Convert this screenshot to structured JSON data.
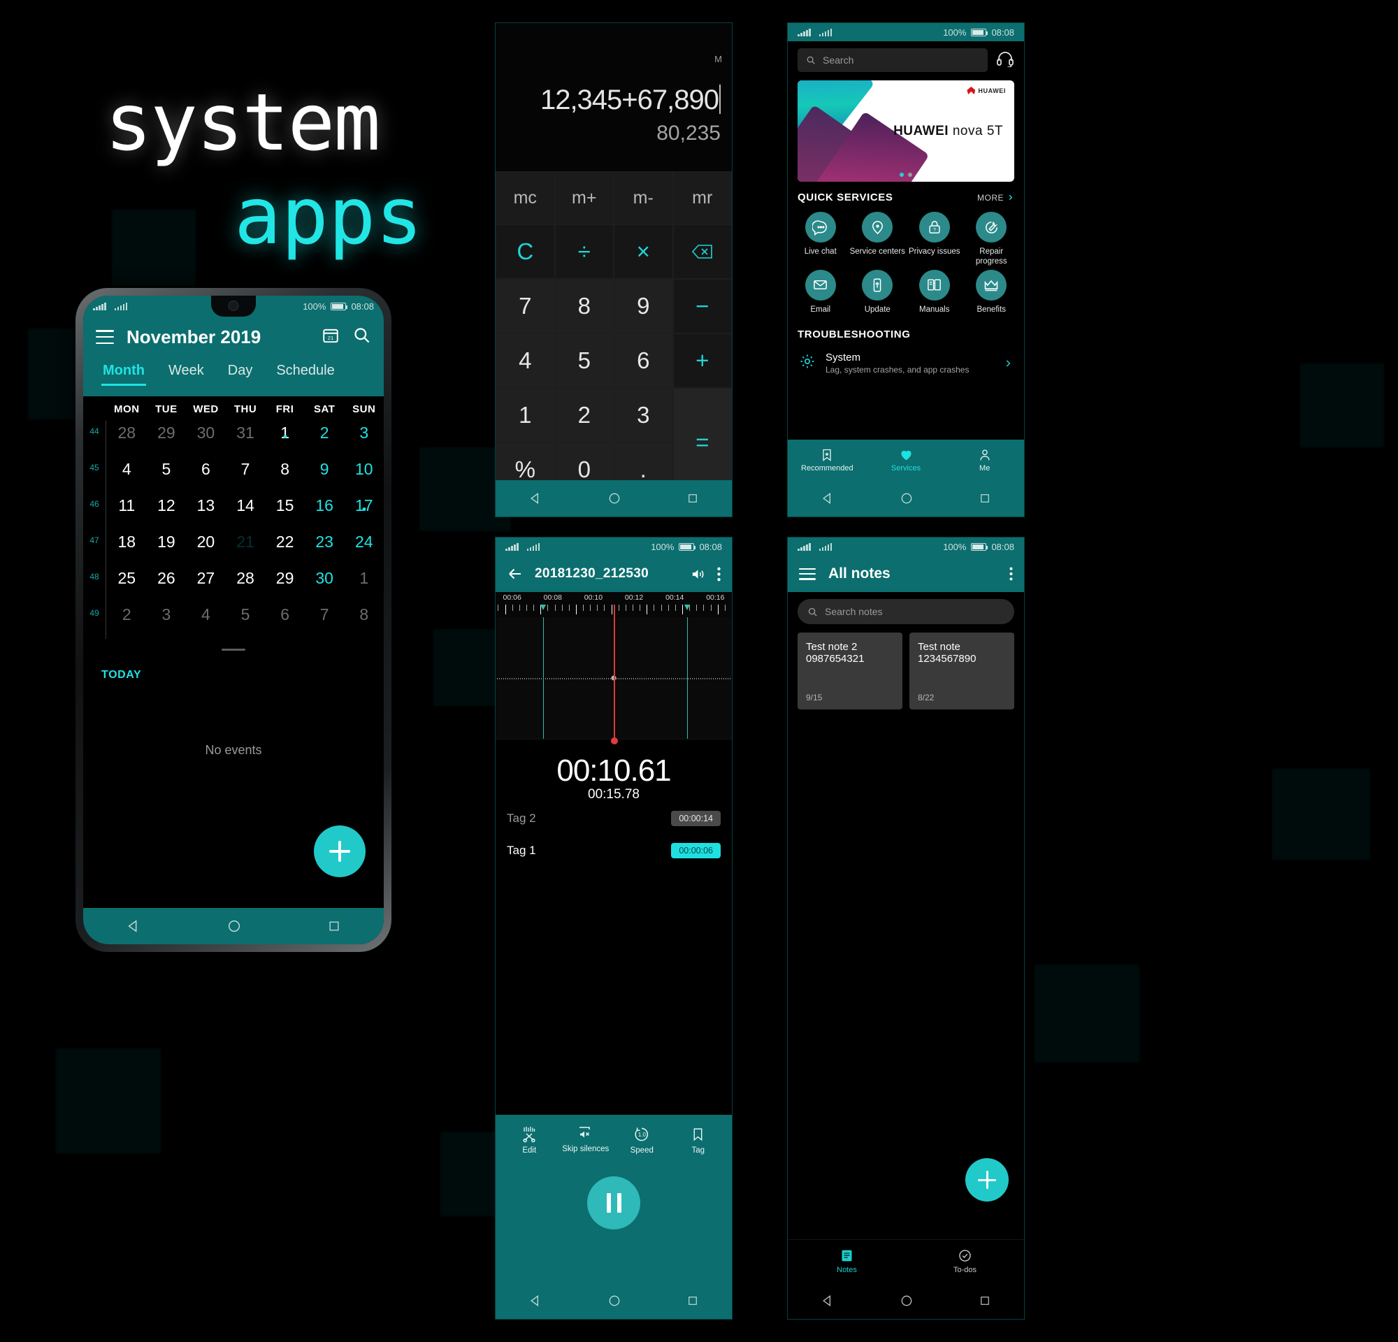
{
  "brand": {
    "line1": "system",
    "line2": "apps"
  },
  "status": {
    "battery": "100%",
    "time": "08:08"
  },
  "calendar": {
    "title": "November 2019",
    "menu_icon": "hamburger-icon",
    "goto_icon": "calendar-jump-icon",
    "search_icon": "search-icon",
    "tabs": [
      {
        "label": "Month",
        "active": true
      },
      {
        "label": "Week",
        "active": false
      },
      {
        "label": "Day",
        "active": false
      },
      {
        "label": "Schedule",
        "active": false
      }
    ],
    "day_headers": [
      "MON",
      "TUE",
      "WED",
      "THU",
      "FRI",
      "SAT",
      "SUN"
    ],
    "week_numbers": [
      "44",
      "45",
      "46",
      "47",
      "48",
      "49"
    ],
    "weeks": [
      [
        {
          "d": "28",
          "dim": true
        },
        {
          "d": "29",
          "dim": true
        },
        {
          "d": "30",
          "dim": true
        },
        {
          "d": "31",
          "dim": true
        },
        {
          "d": "1",
          "dot": true
        },
        {
          "d": "2",
          "weekend": true
        },
        {
          "d": "3",
          "weekend": true
        }
      ],
      [
        {
          "d": "4"
        },
        {
          "d": "5"
        },
        {
          "d": "6"
        },
        {
          "d": "7"
        },
        {
          "d": "8"
        },
        {
          "d": "9",
          "weekend": true
        },
        {
          "d": "10",
          "weekend": true
        }
      ],
      [
        {
          "d": "11"
        },
        {
          "d": "12"
        },
        {
          "d": "13"
        },
        {
          "d": "14"
        },
        {
          "d": "15"
        },
        {
          "d": "16",
          "weekend": true
        },
        {
          "d": "17",
          "weekend": true,
          "dot": true
        }
      ],
      [
        {
          "d": "18"
        },
        {
          "d": "19"
        },
        {
          "d": "20"
        },
        {
          "d": "21",
          "today": true
        },
        {
          "d": "22"
        },
        {
          "d": "23",
          "weekend": true
        },
        {
          "d": "24",
          "weekend": true
        }
      ],
      [
        {
          "d": "25"
        },
        {
          "d": "26"
        },
        {
          "d": "27"
        },
        {
          "d": "28"
        },
        {
          "d": "29"
        },
        {
          "d": "30",
          "weekend": true
        },
        {
          "d": "1",
          "dim": true
        }
      ],
      [
        {
          "d": "2",
          "dim": true
        },
        {
          "d": "3",
          "dim": true
        },
        {
          "d": "4",
          "dim": true
        },
        {
          "d": "5",
          "dim": true
        },
        {
          "d": "6",
          "dim": true
        },
        {
          "d": "7",
          "dim": true
        },
        {
          "d": "8",
          "dim": true
        }
      ]
    ],
    "today_label": "TODAY",
    "no_events": "No events",
    "fab": "add-event-button"
  },
  "calculator": {
    "memory_indicator": "M",
    "expression": "12,345+67,890",
    "result": "80,235",
    "memory_keys": [
      "mc",
      "m+",
      "m-",
      "mr"
    ],
    "keys": [
      {
        "label": "C",
        "type": "op"
      },
      {
        "label": "÷",
        "type": "op"
      },
      {
        "label": "×",
        "type": "op"
      },
      {
        "label": "backspace-icon",
        "type": "icon"
      },
      {
        "label": "7",
        "type": "num"
      },
      {
        "label": "8",
        "type": "num"
      },
      {
        "label": "9",
        "type": "num"
      },
      {
        "label": "−",
        "type": "op"
      },
      {
        "label": "4",
        "type": "num"
      },
      {
        "label": "5",
        "type": "num"
      },
      {
        "label": "6",
        "type": "num"
      },
      {
        "label": "+",
        "type": "op"
      },
      {
        "label": "1",
        "type": "num"
      },
      {
        "label": "2",
        "type": "num"
      },
      {
        "label": "3",
        "type": "num"
      },
      {
        "label": "=",
        "type": "eq"
      },
      {
        "label": "%",
        "type": "num"
      },
      {
        "label": "0",
        "type": "num"
      },
      {
        "label": ".",
        "type": "num"
      }
    ]
  },
  "support": {
    "search_placeholder": "Search",
    "headset_icon": "headset-support-icon",
    "banner": {
      "brand": "HUAWEI",
      "title_bold": "HUAWEI",
      "title_light": "nova 5T",
      "dots": 2,
      "active_dot": 0
    },
    "quick_services_title": "QUICK SERVICES",
    "more_label": "MORE",
    "quick_services": [
      {
        "label": "Live chat",
        "icon": "chat-bubble-icon"
      },
      {
        "label": "Service centers",
        "icon": "location-pin-icon"
      },
      {
        "label": "Privacy issues",
        "icon": "lock-question-icon"
      },
      {
        "label": "Repair progress",
        "icon": "wrench-icon"
      },
      {
        "label": "Email",
        "icon": "envelope-icon"
      },
      {
        "label": "Update",
        "icon": "phone-upload-icon"
      },
      {
        "label": "Manuals",
        "icon": "book-icon"
      },
      {
        "label": "Benefits",
        "icon": "crown-icon"
      }
    ],
    "troubleshooting_title": "TROUBLESHOOTING",
    "troubleshooting": {
      "icon": "gear-icon",
      "title": "System",
      "subtitle": "Lag, system crashes, and app crashes",
      "chevron": "chevron-right-icon"
    },
    "bottom_nav": [
      {
        "label": "Recommended",
        "icon": "bookmark-star-icon",
        "active": false
      },
      {
        "label": "Services",
        "icon": "heart-icon",
        "active": true
      },
      {
        "label": "Me",
        "icon": "person-icon",
        "active": false
      }
    ]
  },
  "recorder": {
    "back_icon": "back-arrow-icon",
    "file_name": "20181230_212530",
    "speaker_icon": "speaker-icon",
    "overflow_icon": "more-vertical-icon",
    "ruler_labels": [
      "00:06",
      "00:08",
      "00:10",
      "00:12",
      "00:14",
      "00:16"
    ],
    "current_time": "00:10.61",
    "total_time": "00:15.78",
    "tags": [
      {
        "name": "Tag 2",
        "time": "00:00:14",
        "active": false
      },
      {
        "name": "Tag 1",
        "time": "00:00:06",
        "active": true
      }
    ],
    "tools": [
      {
        "label": "Edit",
        "icon": "scissors-waveform-icon"
      },
      {
        "label": "Skip silences",
        "icon": "mute-speaker-icon"
      },
      {
        "label": "Speed",
        "icon": "speed-1-0-icon"
      },
      {
        "label": "Tag",
        "icon": "bookmark-icon"
      }
    ],
    "transport": "pause-button"
  },
  "notes": {
    "menu_icon": "hamburger-icon",
    "title": "All notes",
    "overflow_icon": "more-vertical-icon",
    "search_placeholder": "Search notes",
    "items": [
      {
        "title": "Test note 2",
        "body": "0987654321",
        "date": "9/15"
      },
      {
        "title": "Test note",
        "body": "1234567890",
        "date": "8/22"
      }
    ],
    "fab": "add-note-button",
    "bottom_nav": [
      {
        "label": "Notes",
        "icon": "note-icon",
        "active": true
      },
      {
        "label": "To-dos",
        "icon": "check-circle-icon",
        "active": false
      }
    ]
  },
  "colors": {
    "teal": "#0c6e6e",
    "cyan": "#1fe3e3",
    "accent": "#22c9c9"
  }
}
